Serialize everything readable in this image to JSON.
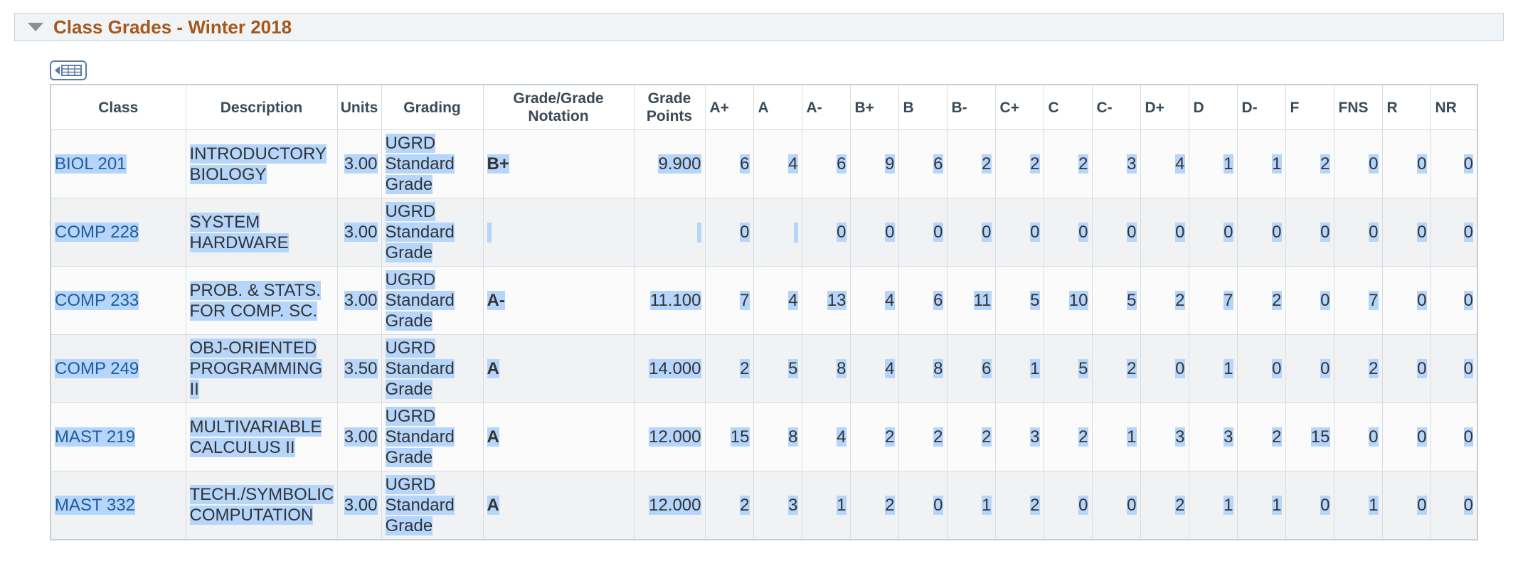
{
  "section": {
    "title": "Class Grades - Winter 2018"
  },
  "icons": {
    "collapse": "triangle-down-icon",
    "grid_toggle": "grid-view-toggle-icon"
  },
  "colors": {
    "title": "#a6581c",
    "link": "#1f5c99",
    "selection": "#b5d5fb"
  },
  "table": {
    "headers": [
      "Class",
      "Description",
      "Units",
      "Grading",
      "Grade/Grade Notation",
      "Grade Points",
      "A+",
      "A",
      "A-",
      "B+",
      "B",
      "B-",
      "C+",
      "C",
      "C-",
      "D+",
      "D",
      "D-",
      "F",
      "FNS",
      "R",
      "NR"
    ],
    "rows": [
      {
        "class": "BIOL 201",
        "description": "INTRODUCTORY BIOLOGY",
        "units": "3.00",
        "grading": "UGRD Standard Grade",
        "grade": "B+",
        "points": "9.900",
        "dist": [
          "6",
          "4",
          "6",
          "9",
          "6",
          "2",
          "2",
          "2",
          "3",
          "4",
          "1",
          "1",
          "2",
          "0",
          "0",
          "0"
        ]
      },
      {
        "class": "COMP 228",
        "description": "SYSTEM HARDWARE",
        "units": "3.00",
        "grading": "UGRD Standard Grade",
        "grade": "",
        "points": "",
        "dist": [
          "0",
          "",
          "0",
          "0",
          "0",
          "0",
          "0",
          "0",
          "0",
          "0",
          "0",
          "0",
          "0",
          "0",
          "0",
          "0"
        ]
      },
      {
        "class": "COMP 233",
        "description": "PROB. & STATS. FOR COMP. SC.",
        "units": "3.00",
        "grading": "UGRD Standard Grade",
        "grade": "A-",
        "points": "11.100",
        "dist": [
          "7",
          "4",
          "13",
          "4",
          "6",
          "11",
          "5",
          "10",
          "5",
          "2",
          "7",
          "2",
          "0",
          "7",
          "0",
          "0"
        ]
      },
      {
        "class": "COMP 249",
        "description": "OBJ-ORIENTED PROGRAMMING II",
        "units": "3.50",
        "grading": "UGRD Standard Grade",
        "grade": "A",
        "points": "14.000",
        "dist": [
          "2",
          "5",
          "8",
          "4",
          "8",
          "6",
          "1",
          "5",
          "2",
          "0",
          "1",
          "0",
          "0",
          "2",
          "0",
          "0"
        ]
      },
      {
        "class": "MAST 219",
        "description": "MULTIVARIABLE CALCULUS II",
        "units": "3.00",
        "grading": "UGRD Standard Grade",
        "grade": "A",
        "points": "12.000",
        "dist": [
          "15",
          "8",
          "4",
          "2",
          "2",
          "2",
          "3",
          "2",
          "1",
          "3",
          "3",
          "2",
          "15",
          "0",
          "0",
          "0"
        ]
      },
      {
        "class": "MAST 332",
        "description": "TECH./SYMBOLIC COMPUTATION",
        "units": "3.00",
        "grading": "UGRD Standard Grade",
        "grade": "A",
        "points": "12.000",
        "dist": [
          "2",
          "3",
          "1",
          "2",
          "0",
          "1",
          "2",
          "0",
          "0",
          "2",
          "1",
          "1",
          "0",
          "1",
          "0",
          "0"
        ]
      }
    ]
  }
}
